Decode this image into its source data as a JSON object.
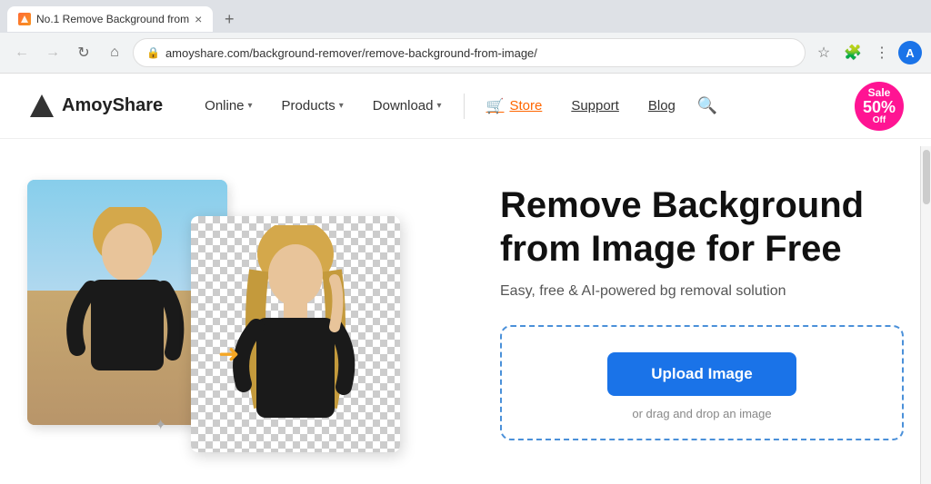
{
  "browser": {
    "tab_title": "No.1 Remove Background from",
    "tab_close": "×",
    "tab_new": "+",
    "back_btn": "←",
    "forward_btn": "→",
    "refresh_btn": "↻",
    "home_btn": "⌂",
    "address": "amoyshare.com/background-remover/remove-background-from-image/",
    "profile_letter": "A"
  },
  "nav": {
    "logo_text": "AmoyShare",
    "online_label": "Online",
    "products_label": "Products",
    "download_label": "Download",
    "store_label": "Store",
    "support_label": "Support",
    "blog_label": "Blog",
    "sale_top": "Sale",
    "sale_pct": "50%",
    "sale_off": "Off"
  },
  "hero": {
    "title_line1": "Remove Background",
    "title_line2": "from Image for Free",
    "subtitle": "Easy, free & AI-powered bg removal solution",
    "upload_btn_label": "Upload Image",
    "drag_hint": "or drag and drop an image"
  }
}
